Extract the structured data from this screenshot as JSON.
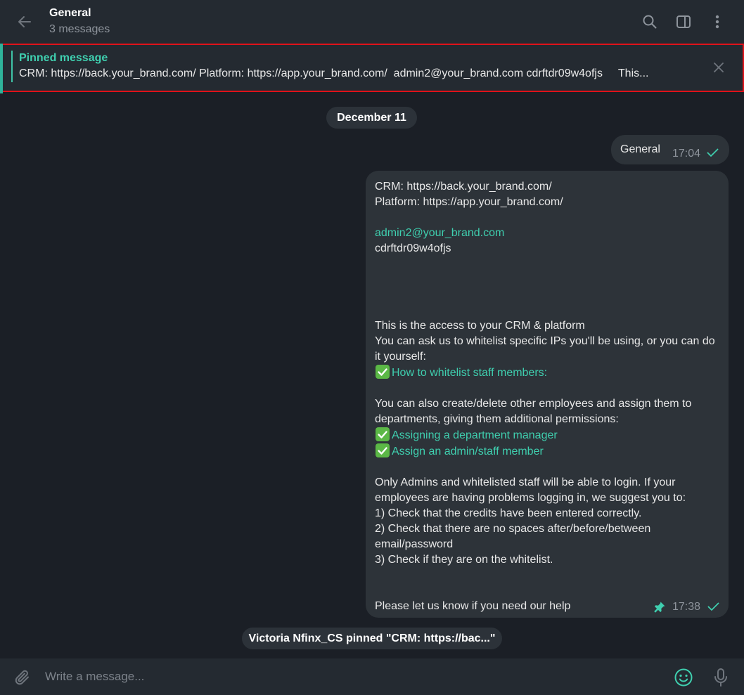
{
  "header": {
    "title": "General",
    "subtitle": "3 messages",
    "icons": [
      "back-arrow-icon",
      "search-icon",
      "sidebar-toggle-icon",
      "more-vertical-icon"
    ]
  },
  "pinned": {
    "label": "Pinned message",
    "text": "CRM: https://back.your_brand.com/ Platform: https://app.your_brand.com/  admin2@your_brand.com cdrftdr09w4ofjs     This..."
  },
  "chat": {
    "date": "December 11",
    "messages": [
      {
        "text": "General",
        "time": "17:04"
      },
      {
        "time": "17:38",
        "lines": {
          "l1": "CRM: https://back.your_brand.com/",
          "l2": "Platform: https://app.your_brand.com/",
          "l3": "admin2@your_brand.com",
          "l4": "cdrftdr09w4ofjs",
          "l5": "This is the access to your CRM & platform",
          "l6": "You can ask us to whitelist specific IPs you'll be using, or you can do it yourself:",
          "l7": "How to whitelist staff members:",
          "l8": "You can also create/delete other employees and assign them to departments, giving them additional permissions:",
          "l9": "Assigning a department manager",
          "l10": "Assign an admin/staff member",
          "l11": "Only Admins and whitelisted staff will be able to login. If your employees are having problems logging in, we suggest you to:",
          "l12": "1) Check that the credits have been entered correctly.",
          "l13": "2) Check that there are no spaces after/before/between email/password",
          "l14": "3) Check if they are on the whitelist.",
          "l15": "Please let us know if you need our help"
        }
      }
    ],
    "service": "Victoria Nfinx_CS pinned \"CRM: https://bac...\""
  },
  "composer": {
    "placeholder": "Write a message..."
  },
  "colors": {
    "accent": "#3fcfaf",
    "highlight_border": "#e0121a",
    "background": "#1b1f26",
    "bubble": "#2d3339"
  }
}
